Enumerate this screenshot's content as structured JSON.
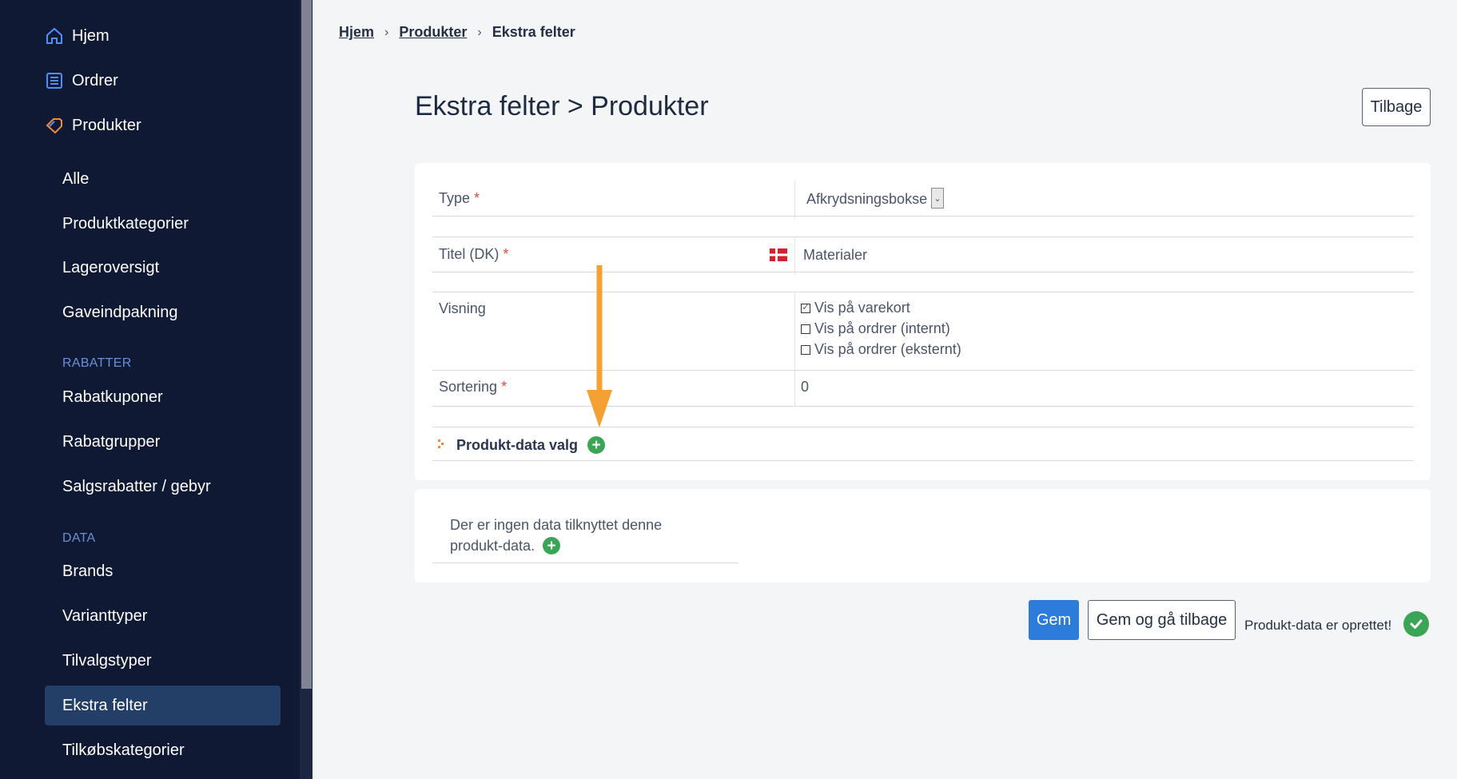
{
  "sidebar": {
    "top_items": [
      {
        "label": "Hjem",
        "icon": "home-icon"
      },
      {
        "label": "Ordrer",
        "icon": "orders-icon"
      },
      {
        "label": "Produkter",
        "icon": "tag-icon"
      }
    ],
    "product_items": [
      "Alle",
      "Produktkategorier",
      "Lageroversigt",
      "Gaveindpakning"
    ],
    "section_discounts": "RABATTER",
    "discount_items": [
      "Rabatkuponer",
      "Rabatgrupper",
      "Salgsrabatter / gebyr"
    ],
    "section_data": "DATA",
    "data_items": [
      "Brands",
      "Varianttyper",
      "Tilvalgstyper",
      "Ekstra felter",
      "Tilkøbskategorier"
    ],
    "active_item": "Ekstra felter"
  },
  "breadcrumb": {
    "home": "Hjem",
    "products": "Produkter",
    "current": "Ekstra felter"
  },
  "page": {
    "title": "Ekstra felter > Produkter",
    "back_label": "Tilbage"
  },
  "form": {
    "type_label": "Type",
    "type_value": "Afkrydsningsbokse",
    "title_label": "Titel (DK)",
    "title_value": "Materialer",
    "display_label": "Visning",
    "display_options": [
      {
        "label": "Vis på varekort",
        "checked": true
      },
      {
        "label": "Vis på ordrer (internt)",
        "checked": false
      },
      {
        "label": "Vis på ordrer (eksternt)",
        "checked": false
      }
    ],
    "sort_label": "Sortering",
    "sort_value": "0",
    "required_mark": "*",
    "product_data_label": "Produkt-data valg"
  },
  "empty_state": {
    "line1": "Der er ingen data tilknyttet denne",
    "line2": "produkt-data."
  },
  "actions": {
    "save": "Gem",
    "save_back": "Gem og gå tilbage",
    "status": "Produkt-data er oprettet!"
  },
  "colors": {
    "sidebar_bg": "#0f1934",
    "active_bg": "#233f68",
    "primary": "#2d7cdc",
    "success": "#3aa655",
    "annotation_arrow": "#f5a032"
  }
}
